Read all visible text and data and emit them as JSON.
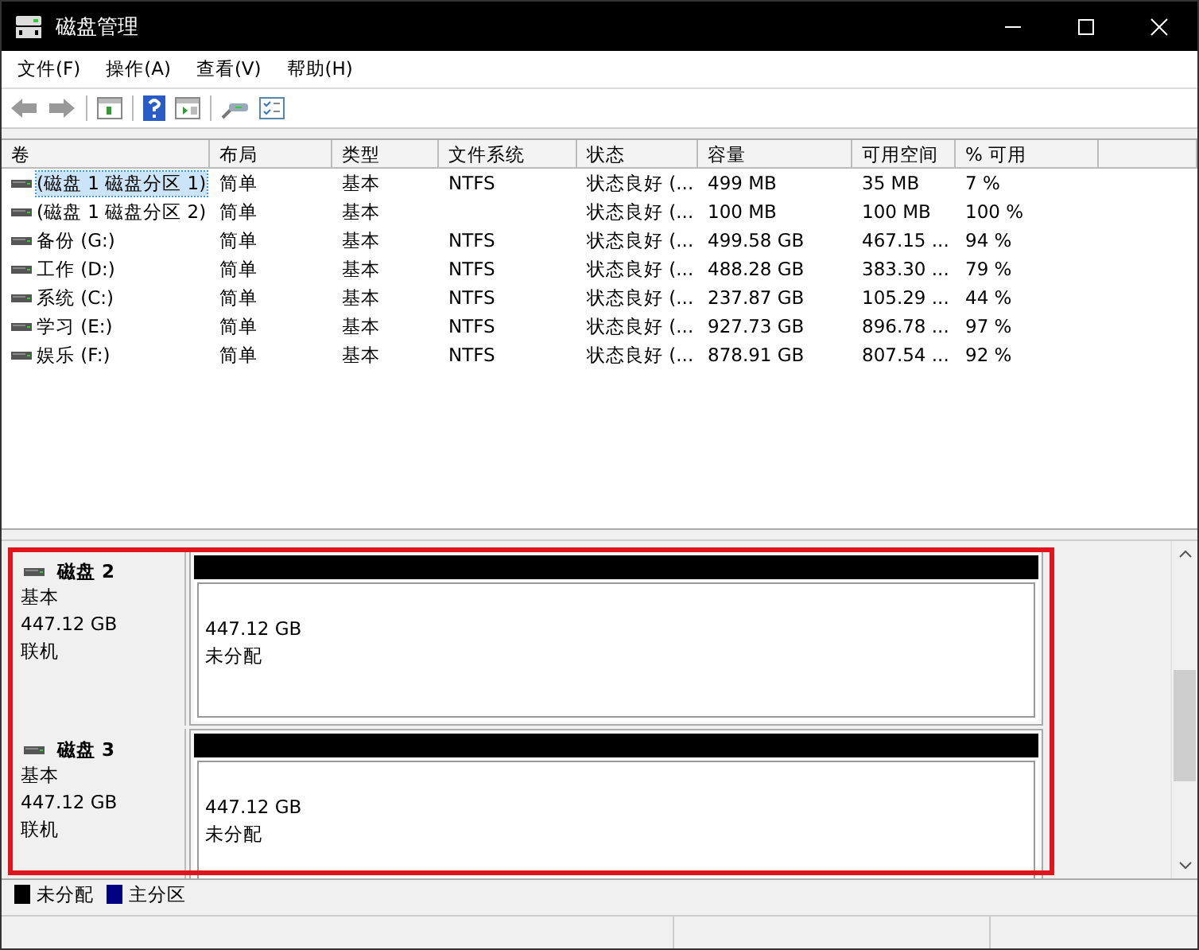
{
  "window": {
    "title": "磁盘管理"
  },
  "menu": [
    "文件(F)",
    "操作(A)",
    "查看(V)",
    "帮助(H)"
  ],
  "volume_table": {
    "columns": [
      "卷",
      "布局",
      "类型",
      "文件系统",
      "状态",
      "容量",
      "可用空间",
      "% 可用"
    ],
    "rows": [
      {
        "cells": [
          "(磁盘 1 磁盘分区 1)",
          "简单",
          "基本",
          "NTFS",
          "状态良好 (...",
          "499 MB",
          "35 MB",
          "7 %"
        ],
        "selected": true
      },
      {
        "cells": [
          "(磁盘 1 磁盘分区 2)",
          "简单",
          "基本",
          "",
          "状态良好 (...",
          "100 MB",
          "100 MB",
          "100 %"
        ],
        "selected": false
      },
      {
        "cells": [
          "备份 (G:)",
          "简单",
          "基本",
          "NTFS",
          "状态良好 (...",
          "499.58 GB",
          "467.15 ...",
          "94 %"
        ],
        "selected": false
      },
      {
        "cells": [
          "工作 (D:)",
          "简单",
          "基本",
          "NTFS",
          "状态良好 (...",
          "488.28 GB",
          "383.30 ...",
          "79 %"
        ],
        "selected": false
      },
      {
        "cells": [
          "系统 (C:)",
          "简单",
          "基本",
          "NTFS",
          "状态良好 (...",
          "237.87 GB",
          "105.29 ...",
          "44 %"
        ],
        "selected": false
      },
      {
        "cells": [
          "学习 (E:)",
          "简单",
          "基本",
          "NTFS",
          "状态良好 (...",
          "927.73 GB",
          "896.78 ...",
          "97 %"
        ],
        "selected": false
      },
      {
        "cells": [
          "娱乐 (F:)",
          "简单",
          "基本",
          "NTFS",
          "状态良好 (...",
          "878.91 GB",
          "807.54 ...",
          "92 %"
        ],
        "selected": false
      }
    ]
  },
  "disks": [
    {
      "name": "磁盘 2",
      "type": "基本",
      "size": "447.12 GB",
      "status": "联机",
      "partitions": [
        {
          "kind": "unallocated",
          "color": "#000000",
          "size": "447.12 GB",
          "label": "未分配"
        }
      ]
    },
    {
      "name": "磁盘 3",
      "type": "基本",
      "size": "447.12 GB",
      "status": "联机",
      "partitions": [
        {
          "kind": "unallocated",
          "color": "#000000",
          "size": "447.12 GB",
          "label": "未分配"
        }
      ]
    }
  ],
  "legend": [
    {
      "label": "未分配",
      "color": "#000000"
    },
    {
      "label": "主分区",
      "color": "#000080"
    }
  ]
}
